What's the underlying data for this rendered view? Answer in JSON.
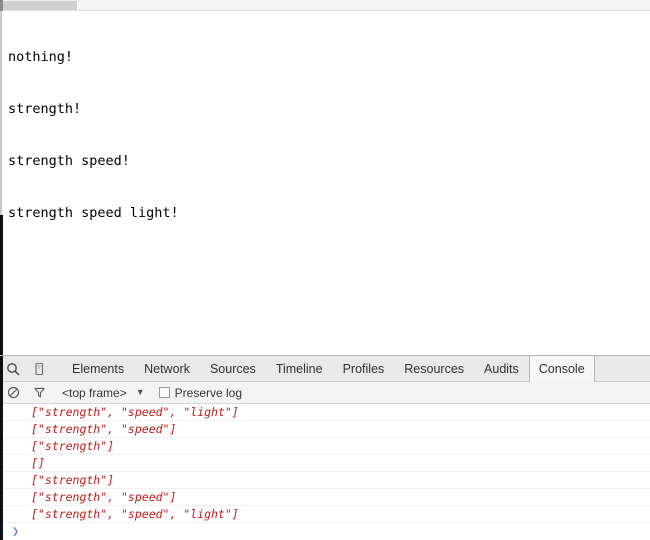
{
  "window": {
    "scrollbar": {
      "orientation": "horizontal"
    }
  },
  "page": {
    "lines": [
      "nothing!",
      "strength!",
      "strength speed!",
      "strength speed light!"
    ]
  },
  "devtools": {
    "toolbar_icons": [
      {
        "name": "inspect-search-icon",
        "glyph": "search"
      },
      {
        "name": "device-toolbar-icon",
        "glyph": "device"
      }
    ],
    "tabs": [
      {
        "label": "Elements",
        "active": false
      },
      {
        "label": "Network",
        "active": false
      },
      {
        "label": "Sources",
        "active": false
      },
      {
        "label": "Timeline",
        "active": false
      },
      {
        "label": "Profiles",
        "active": false
      },
      {
        "label": "Resources",
        "active": false
      },
      {
        "label": "Audits",
        "active": false
      },
      {
        "label": "Console",
        "active": true
      }
    ],
    "options": {
      "clear_icon": "clear-console-icon",
      "filter_icon": "filter-funnel-icon",
      "frame_selector": "<top frame>",
      "frame_caret": "▼",
      "preserve_log_label": "Preserve log",
      "preserve_log_checked": false
    },
    "console": {
      "messages": [
        "[\"strength\", \"speed\", \"light\"]",
        "[\"strength\", \"speed\"]",
        "[\"strength\"]",
        "[]",
        "[\"strength\"]",
        "[\"strength\", \"speed\"]",
        "[\"strength\", \"speed\", \"light\"]"
      ],
      "prompt_symbol": "❯"
    }
  },
  "colors": {
    "console_string": "#c41a16",
    "console_bracket": "#8b3a35",
    "prompt": "#6a8fd8",
    "tabstrip_bg": "#e9e9e9",
    "optionsbar_bg": "#f3f3f3"
  }
}
